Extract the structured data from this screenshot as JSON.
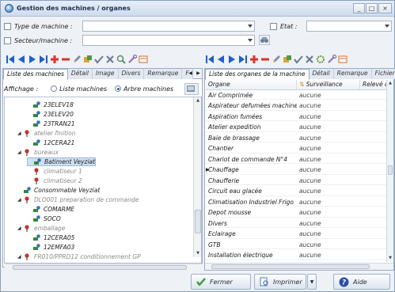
{
  "window": {
    "title": "Gestion des machines / organes",
    "controls": {
      "minimize": "_",
      "restore": "□",
      "close": "×"
    }
  },
  "filters": {
    "type_label": "Type de machine :",
    "secteur_label": "Secteur/machine :",
    "etat_label": "Etat :"
  },
  "left_tabs": [
    "Liste des machines",
    "Détail",
    "Image",
    "Divers",
    "Remarque",
    "F"
  ],
  "right_tabs": [
    "Liste des organes de la machine",
    "Détail",
    "Remarque",
    "Fichiers"
  ],
  "affichage": {
    "label": "Affichage :",
    "option_list": "Liste machines",
    "option_tree": "Arbre machines",
    "selected": "Arbre machines"
  },
  "tree": [
    {
      "label": "23ELEV18",
      "depth": 2,
      "icon": "machine-icon",
      "dim": false
    },
    {
      "label": "23ELEV20",
      "depth": 2,
      "icon": "machine-icon",
      "dim": false
    },
    {
      "label": "23TRAN21",
      "depth": 2,
      "icon": "machine-icon",
      "dim": false
    },
    {
      "label": "atelier finition",
      "depth": 1,
      "icon": "location-pin-icon",
      "dim": true,
      "expanded": true
    },
    {
      "label": "12CERA21",
      "depth": 2,
      "icon": "machine-icon",
      "dim": false
    },
    {
      "label": "bureaux",
      "depth": 1,
      "icon": "location-pin-icon",
      "dim": true,
      "expanded": true
    },
    {
      "label": "Batiment Veyziat",
      "depth": 2,
      "icon": "machine-icon",
      "dim": false,
      "selected": true
    },
    {
      "label": "climatiseur 1",
      "depth": 2,
      "icon": "location-pin-icon",
      "dim": true
    },
    {
      "label": "climatiseur 2",
      "depth": 2,
      "icon": "location-pin-icon",
      "dim": true
    },
    {
      "label": "Consommable Veyziat",
      "depth": 1,
      "icon": "machine-icon",
      "dim": false
    },
    {
      "label": "DLO001 preparation de commande",
      "depth": 1,
      "icon": "location-pin-icon",
      "dim": true,
      "expanded": true
    },
    {
      "label": "COMARME",
      "depth": 2,
      "icon": "machine-icon",
      "dim": false
    },
    {
      "label": "SOCO",
      "depth": 2,
      "icon": "machine-icon",
      "dim": false
    },
    {
      "label": "emballage",
      "depth": 1,
      "icon": "location-pin-icon",
      "dim": true,
      "expanded": true
    },
    {
      "label": "12CERA05",
      "depth": 2,
      "icon": "machine-icon",
      "dim": false
    },
    {
      "label": "12EMFA03",
      "depth": 2,
      "icon": "machine-icon",
      "dim": false
    },
    {
      "label": "FR010/PPRD12  conditionnement GP",
      "depth": 1,
      "icon": "location-pin-icon",
      "dim": true,
      "expanded": true
    }
  ],
  "table": {
    "columns": [
      "Organe",
      "Surveillance",
      "Relevé c"
    ],
    "rows": [
      {
        "organe": "Air Comprimée",
        "surveillance": "aucune"
      },
      {
        "organe": "Aspirateur defumées machine a le",
        "surveillance": "aucune"
      },
      {
        "organe": "Aspiration fumées",
        "surveillance": "aucune"
      },
      {
        "organe": "Atelier expedition",
        "surveillance": "aucune"
      },
      {
        "organe": "Baie de brassage",
        "surveillance": "aucune"
      },
      {
        "organe": "Chantier",
        "surveillance": "aucune"
      },
      {
        "organe": "Chariot de commande N°4",
        "surveillance": "aucune"
      },
      {
        "organe": "Chauffage",
        "surveillance": "aucune",
        "current": true
      },
      {
        "organe": "Chaufferie",
        "surveillance": "aucune"
      },
      {
        "organe": "Circuit eau glacée",
        "surveillance": "aucune"
      },
      {
        "organe": "Climatisation Industriel Frigo",
        "surveillance": "aucune"
      },
      {
        "organe": "Depot mousse",
        "surveillance": "aucune"
      },
      {
        "organe": "Divers",
        "surveillance": "aucune"
      },
      {
        "organe": "Eclairage",
        "surveillance": "aucune"
      },
      {
        "organe": "GTB",
        "surveillance": "aucune"
      },
      {
        "organe": "Installation électrique",
        "surveillance": "aucune"
      }
    ]
  },
  "buttons": {
    "fermer": "Fermer",
    "imprimer": "Imprimer",
    "aide": "Aide"
  },
  "colors": {
    "nav_blue": "#1f5fc9",
    "add_red": "#d9342b",
    "machine_green": "#2f8a3a",
    "pin_red": "#c8322a"
  }
}
